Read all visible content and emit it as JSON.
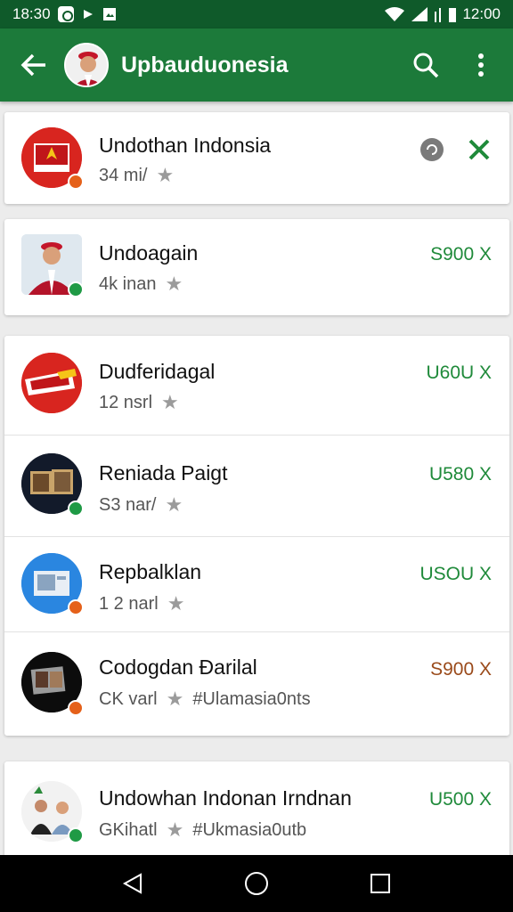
{
  "status_bar": {
    "time_left": "18:30",
    "time_right": "12:00"
  },
  "app_bar": {
    "title": "Upbauduonesia"
  },
  "items": [
    {
      "title": "Undothan Indonsia",
      "subtitle": "34 mi/",
      "tag": "",
      "price": "",
      "badge": "orange"
    },
    {
      "title": "Undoagain",
      "subtitle": "4k inan",
      "tag": "",
      "price": "S900 X",
      "badge": "green"
    },
    {
      "title": "Dudferidagal",
      "subtitle": "12 nsrl",
      "tag": "",
      "price": "U60U X",
      "badge": "none"
    },
    {
      "title": "Reniada Paigt",
      "subtitle": "S3 nar/",
      "tag": "",
      "price": "U580 X",
      "badge": "green"
    },
    {
      "title": "Repbalklan",
      "subtitle": "1 2 narl",
      "tag": "",
      "price": "USOU X",
      "badge": "orange"
    },
    {
      "title": "Codogdan Ɖarilal",
      "subtitle": "CK varl",
      "tag": "#Ulamasia0nts",
      "price": "S900 X",
      "badge": "orange"
    },
    {
      "title": "Undowhan Indonan Irndnan",
      "subtitle": "GKihatl",
      "tag": "#Ukmasia0utb",
      "price": "U500 X",
      "badge": "green"
    }
  ],
  "colors": {
    "app_bar": "#1c7a3a",
    "status_bar": "#0f5a2a",
    "price_green": "#1f8a3a",
    "price_brown": "#9a4a1a"
  },
  "icons": {
    "back": "arrow-left-icon",
    "search": "search-icon",
    "menu": "more-vert-icon",
    "star": "star-icon",
    "close": "close-icon"
  }
}
